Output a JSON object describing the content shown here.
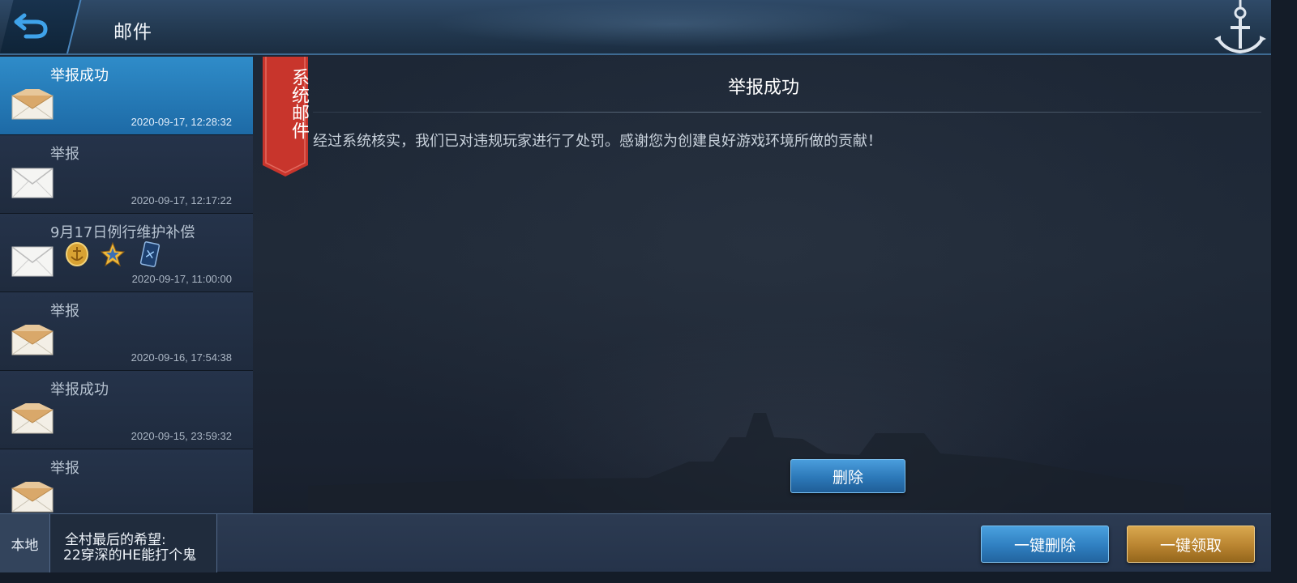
{
  "header": {
    "title": "邮件",
    "back_icon": "back-arrow-icon",
    "anchor_icon": "anchor-icon"
  },
  "mail_list": [
    {
      "title": "举报成功",
      "time": "2020-09-17, 12:28:32",
      "envelope": "open",
      "selected": true,
      "attachments": []
    },
    {
      "title": "举报",
      "time": "2020-09-17, 12:17:22",
      "envelope": "closed",
      "selected": false,
      "attachments": []
    },
    {
      "title": "9月17日例行维护补偿",
      "time": "2020-09-17, 11:00:00",
      "envelope": "closed",
      "selected": false,
      "attachments": [
        "gold-coin-icon",
        "star-medal-icon",
        "card-icon"
      ]
    },
    {
      "title": "举报",
      "time": "2020-09-16, 17:54:38",
      "envelope": "open",
      "selected": false,
      "attachments": []
    },
    {
      "title": "举报成功",
      "time": "2020-09-15, 23:59:32",
      "envelope": "open",
      "selected": false,
      "attachments": []
    },
    {
      "title": "举报",
      "time": "",
      "envelope": "open",
      "selected": false,
      "attachments": []
    }
  ],
  "mail_detail": {
    "ribbon": "系统邮件",
    "title": "举报成功",
    "body": "经过系统核实，我们已对违规玩家进行了处罚。感谢您为创建良好游戏环境所做的贡献！",
    "delete_label": "删除"
  },
  "footer": {
    "chat_channel": "本地",
    "chat_line1": "全村最后的希望:",
    "chat_line2": "22穿深的HE能打个鬼",
    "delete_all_label": "一键删除",
    "claim_all_label": "一键领取"
  },
  "colors": {
    "accent_blue": "#2f8cc9",
    "gold": "#c08a35",
    "ribbon_red": "#c8352c"
  }
}
